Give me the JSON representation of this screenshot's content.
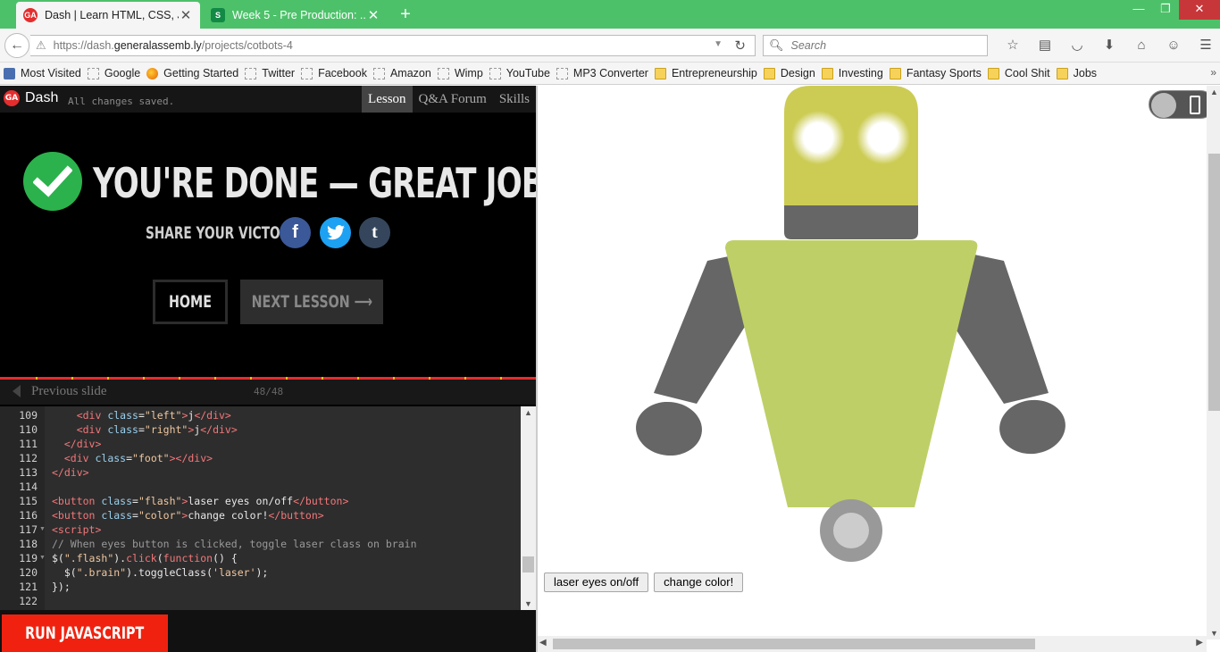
{
  "browser": {
    "tabs": [
      {
        "title": "Dash | Learn HTML, CSS, J...",
        "favicon": "GA",
        "active": true
      },
      {
        "title": "Week 5 - Pre Production: ...",
        "favicon": "S",
        "active": false
      }
    ],
    "url": {
      "prefix": "https://dash.",
      "domain": "generalassemb.ly",
      "path": "/projects/cotbots-4"
    },
    "search_placeholder": "Search",
    "bookmarks": [
      {
        "label": "Most Visited",
        "icon": "most-visited-icon"
      },
      {
        "label": "Google",
        "icon": "page-icon"
      },
      {
        "label": "Getting Started",
        "icon": "firefox-icon"
      },
      {
        "label": "Twitter",
        "icon": "page-icon"
      },
      {
        "label": "Facebook",
        "icon": "page-icon"
      },
      {
        "label": "Amazon",
        "icon": "page-icon"
      },
      {
        "label": "Wimp",
        "icon": "page-icon"
      },
      {
        "label": "YouTube",
        "icon": "page-icon"
      },
      {
        "label": "MP3 Converter",
        "icon": "page-icon"
      },
      {
        "label": "Entrepreneurship",
        "icon": "folder-icon"
      },
      {
        "label": "Design",
        "icon": "folder-icon"
      },
      {
        "label": "Investing",
        "icon": "folder-icon"
      },
      {
        "label": "Fantasy Sports",
        "icon": "folder-icon"
      },
      {
        "label": "Cool Shit",
        "icon": "folder-icon"
      },
      {
        "label": "Jobs",
        "icon": "folder-icon"
      }
    ],
    "colors": {
      "tabbar": "#4dc16a",
      "close": "#c7373a"
    }
  },
  "dash": {
    "logo": "GA",
    "name": "Dash",
    "status": "All changes saved.",
    "tabs": [
      "Lesson",
      "Q&A Forum",
      "Skills"
    ],
    "done_title": "YOU'RE DONE — GREAT JOB!",
    "share_label": "SHARE YOUR VICTORY:",
    "social": {
      "facebook": "f",
      "twitter": "🐦",
      "tumblr": "t"
    },
    "home_label": "HOME",
    "next_label": "NEXT LESSON ⟶",
    "prev_label": "Previous slide",
    "slide_count": "48/48",
    "run_label": "RUN JAVASCRIPT",
    "colors": {
      "accent": "#e42d2d",
      "check": "#2bb24c",
      "run": "#f0220f"
    }
  },
  "code": {
    "lines": [
      {
        "n": "109",
        "fold": false,
        "tokens": [
          [
            "",
            "    "
          ],
          [
            "tg",
            "<div "
          ],
          [
            "at",
            "class"
          ],
          [
            "",
            "="
          ],
          [
            "st",
            "\"left\""
          ],
          [
            "tg",
            ">"
          ],
          [
            "",
            "j"
          ],
          [
            "tg",
            "</div>"
          ]
        ]
      },
      {
        "n": "110",
        "fold": false,
        "tokens": [
          [
            "",
            "    "
          ],
          [
            "tg",
            "<div "
          ],
          [
            "at",
            "class"
          ],
          [
            "",
            "="
          ],
          [
            "st",
            "\"right\""
          ],
          [
            "tg",
            ">"
          ],
          [
            "",
            "j"
          ],
          [
            "tg",
            "</div>"
          ]
        ]
      },
      {
        "n": "111",
        "fold": false,
        "tokens": [
          [
            "",
            "  "
          ],
          [
            "tg",
            "</div>"
          ]
        ]
      },
      {
        "n": "112",
        "fold": false,
        "tokens": [
          [
            "",
            "  "
          ],
          [
            "tg",
            "<div "
          ],
          [
            "at",
            "class"
          ],
          [
            "",
            "="
          ],
          [
            "st",
            "\"foot\""
          ],
          [
            "tg",
            "></div>"
          ]
        ]
      },
      {
        "n": "113",
        "fold": false,
        "tokens": [
          [
            "tg",
            "</div>"
          ]
        ]
      },
      {
        "n": "114",
        "fold": false,
        "tokens": [
          [
            "",
            ""
          ]
        ]
      },
      {
        "n": "115",
        "fold": false,
        "tokens": [
          [
            "tg",
            "<button "
          ],
          [
            "at",
            "class"
          ],
          [
            "",
            "="
          ],
          [
            "st",
            "\"flash\""
          ],
          [
            "tg",
            ">"
          ],
          [
            "",
            "laser eyes on/off"
          ],
          [
            "tg",
            "</button>"
          ]
        ]
      },
      {
        "n": "116",
        "fold": false,
        "tokens": [
          [
            "tg",
            "<button "
          ],
          [
            "at",
            "class"
          ],
          [
            "",
            "="
          ],
          [
            "st",
            "\"color\""
          ],
          [
            "tg",
            ">"
          ],
          [
            "",
            "change color!"
          ],
          [
            "tg",
            "</button>"
          ]
        ]
      },
      {
        "n": "117",
        "fold": true,
        "tokens": [
          [
            "tg",
            "<script>"
          ]
        ]
      },
      {
        "n": "118",
        "fold": false,
        "tokens": [
          [
            "cm",
            "// When eyes button is clicked, toggle laser class on brain"
          ]
        ]
      },
      {
        "n": "119",
        "fold": true,
        "tokens": [
          [
            "",
            "$("
          ],
          [
            "st",
            "\".flash\""
          ],
          [
            "",
            ")."
          ],
          [
            "fn",
            "click"
          ],
          [
            "",
            "("
          ],
          [
            "fn",
            "function"
          ],
          [
            "",
            "() {"
          ]
        ]
      },
      {
        "n": "120",
        "fold": false,
        "tokens": [
          [
            "",
            "  $("
          ],
          [
            "st",
            "\".brain\""
          ],
          [
            "",
            ").toggleClass("
          ],
          [
            "st",
            "'laser'"
          ],
          [
            "",
            ");"
          ]
        ]
      },
      {
        "n": "121",
        "fold": false,
        "tokens": [
          [
            "",
            "});"
          ]
        ]
      },
      {
        "n": "122",
        "fold": false,
        "tokens": [
          [
            "",
            ""
          ]
        ]
      }
    ]
  },
  "preview": {
    "buttons": [
      "laser eyes on/off",
      "change color!"
    ],
    "colors": {
      "head": "#cccc55",
      "body": "#bfcf67",
      "limbs": "#666666",
      "eyes": "#ffffff",
      "wheel": "#999999",
      "hub": "#cccccc"
    }
  }
}
